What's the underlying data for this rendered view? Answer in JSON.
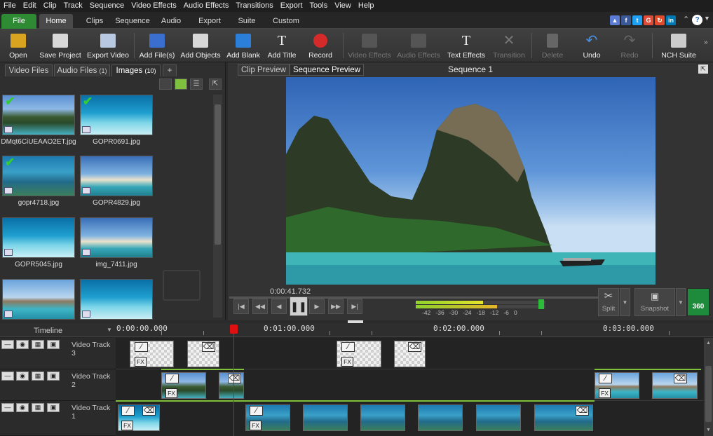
{
  "menu": [
    "File",
    "Edit",
    "Clip",
    "Track",
    "Sequence",
    "Video Effects",
    "Audio Effects",
    "Transitions",
    "Export",
    "Tools",
    "View",
    "Help"
  ],
  "ribbon_tabs": [
    "File",
    "Home",
    "Clips",
    "Sequence",
    "Audio",
    "Export",
    "Suite",
    "Custom"
  ],
  "toolbar": {
    "open": "Open",
    "save_project": "Save Project",
    "export_video": "Export Video",
    "add_files": "Add File(s)",
    "add_objects": "Add Objects",
    "add_blank": "Add Blank",
    "add_title": "Add Title",
    "record": "Record",
    "video_effects": "Video Effects",
    "audio_effects": "Audio Effects",
    "text_effects": "Text Effects",
    "transition": "Transition",
    "delete": "Delete",
    "undo": "Undo",
    "redo": "Redo",
    "nch_suite": "NCH Suite"
  },
  "media": {
    "tabs": {
      "video": "Video Files",
      "audio": "Audio Files",
      "audio_count": "(1)",
      "images": "Images",
      "images_count": "(10)",
      "add": "+"
    },
    "items": [
      {
        "name": "DMqt6CiUEAAO2ET.jpg",
        "checked": true
      },
      {
        "name": "GOPR0691.jpg",
        "checked": true
      },
      {
        "name": "gopr4718.jpg",
        "checked": true
      },
      {
        "name": "GOPR4829.jpg",
        "checked": false
      },
      {
        "name": "GOPR5045.jpg",
        "checked": false
      },
      {
        "name": "img_7411.jpg",
        "checked": false
      },
      {
        "name": "",
        "checked": false
      },
      {
        "name": "",
        "checked": false
      }
    ]
  },
  "preview": {
    "clip_tab": "Clip Preview",
    "sequence_tab": "Sequence Preview",
    "title": "Sequence 1",
    "time": "0:00:41.732",
    "meter_labels": [
      "-42",
      "-36",
      "-30",
      "-24",
      "-18",
      "-12",
      "-6",
      "0"
    ],
    "split": "Split",
    "snapshot": "Snapshot",
    "vr": "360"
  },
  "timeline": {
    "label": "Timeline",
    "ruler": [
      "0:00:00.000",
      "0:01:00.000",
      "0:02:00.000",
      "0:03:00.000"
    ],
    "tracks": [
      {
        "name": "Video Track 3"
      },
      {
        "name": "Video Track 2"
      },
      {
        "name": "Video Track 1"
      }
    ],
    "fx": "FX"
  },
  "colors": {
    "accent_green": "#2e8b34",
    "playhead": "#e01010"
  }
}
